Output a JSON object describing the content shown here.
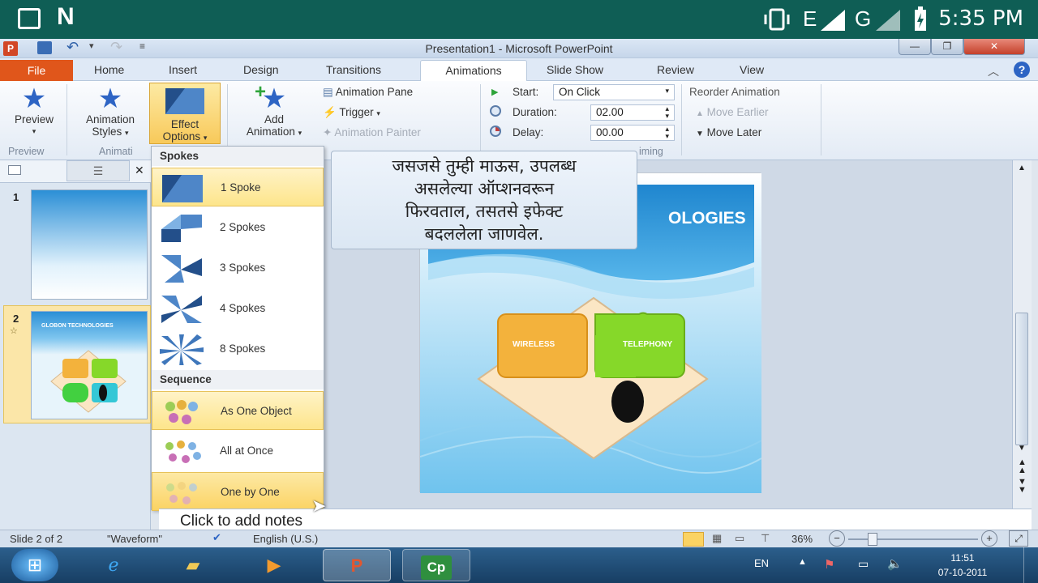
{
  "statusbar": {
    "network1": "E",
    "network2": "G",
    "time": "5:35 PM"
  },
  "window": {
    "title": "Presentation1 - Microsoft PowerPoint"
  },
  "tabs": [
    {
      "label": "File"
    },
    {
      "label": "Home"
    },
    {
      "label": "Insert"
    },
    {
      "label": "Design"
    },
    {
      "label": "Transitions"
    },
    {
      "label": "Animations"
    },
    {
      "label": "Slide Show"
    },
    {
      "label": "Review"
    },
    {
      "label": "View"
    }
  ],
  "ribbon": {
    "preview_label": "Preview",
    "preview_group": "Preview",
    "animation_styles_line1": "Animation",
    "animation_styles_line2": "Styles",
    "animation_group": "Animati",
    "effect_options_line1": "Effect",
    "effect_options_line2": "Options",
    "add_animation_line1": "Add",
    "add_animation_line2": "Animation",
    "animation_pane": "Animation Pane",
    "trigger": "Trigger",
    "animation_painter": "Animation Painter",
    "start_label": "Start:",
    "start_value": "On Click",
    "duration_label": "Duration:",
    "duration_value": "02.00",
    "delay_label": "Delay:",
    "delay_value": "00.00",
    "timing_group": "iming",
    "reorder_title": "Reorder Animation",
    "move_earlier": "Move Earlier",
    "move_later": "Move Later"
  },
  "slides_panel": {
    "slide1_num": "1",
    "slide2_num": "2",
    "slide2_thumb_title": "GLOBON TECHNOLOGIES"
  },
  "menu": {
    "spokes_header": "Spokes",
    "spokes": [
      "1 Spoke",
      "2 Spokes",
      "3 Spokes",
      "4 Spokes",
      "8 Spokes"
    ],
    "sequence_header": "Sequence",
    "sequence": [
      "As One Object",
      "All at Once",
      "One by One"
    ]
  },
  "tooltip": {
    "line1": "जसजसे तुम्ही माऊस, उपलब्ध",
    "line2": "असलेल्या ऑप्शनवरून",
    "line3": "फिरवताल, तसतसे इफेक्ट",
    "line4": "बदललेला जाणवेल."
  },
  "slide": {
    "title_fragment": "OLOGIES",
    "box1": "WIRELESS",
    "box2": "TELEPHONY"
  },
  "notes": {
    "placeholder": "Click to add notes"
  },
  "appstatus": {
    "slide_count": "Slide 2 of 2",
    "theme": "\"Waveform\"",
    "language": "English (U.S.)",
    "zoom": "36%"
  },
  "taskbar": {
    "lang": "EN",
    "time": "11:51",
    "date": "07-10-2011",
    "cp_label": "Cp"
  },
  "colors": {
    "status_bar": "#0f5e55",
    "file_tab": "#e0561b",
    "highlight": "#fde58b",
    "box_orange": "#f3b23c",
    "box_green": "#86d829"
  }
}
